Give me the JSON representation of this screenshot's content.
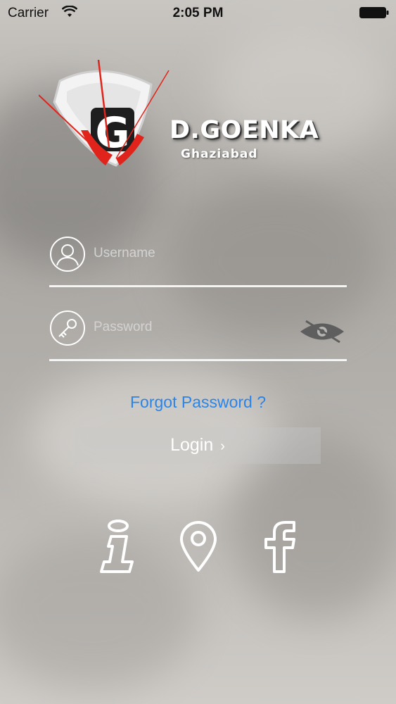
{
  "status_bar": {
    "carrier": "Carrier",
    "time": "2:05 PM"
  },
  "logo": {
    "brand": "D.GOENKA",
    "city": "Ghaziabad",
    "mark_letter": "G"
  },
  "form": {
    "username": {
      "placeholder": "Username",
      "value": ""
    },
    "password": {
      "placeholder": "Password",
      "value": ""
    },
    "forgot_label": "Forgot Password ?",
    "login_label": "Login",
    "login_chevron": "›"
  },
  "social": [
    {
      "icon": "info-icon"
    },
    {
      "icon": "location-pin-icon"
    },
    {
      "icon": "facebook-icon"
    }
  ],
  "colors": {
    "link": "#2b84e8",
    "logo_red": "#e0241b",
    "underline": "#f4f4f4"
  }
}
